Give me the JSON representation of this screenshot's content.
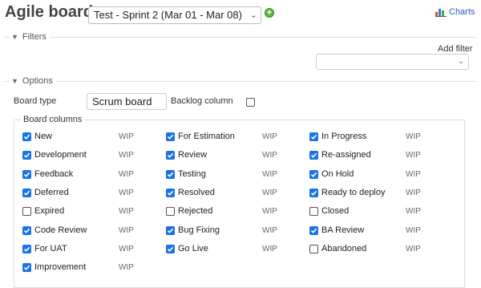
{
  "header": {
    "title": "Agile board",
    "sprint_value": "Test - Sprint 2 (Mar 01 - Mar 08)",
    "charts_label": "Charts"
  },
  "filters": {
    "legend": "Filters",
    "add_filter_label": "Add filter",
    "add_filter_value": ""
  },
  "options": {
    "legend": "Options",
    "board_type_label": "Board type",
    "board_type_value": "Scrum board",
    "backlog_label": "Backlog column",
    "backlog_checked": false,
    "board_columns_legend": "Board columns"
  },
  "columns": [
    [
      {
        "label": "New",
        "checked": true,
        "wip": "WIP"
      },
      {
        "label": "Development",
        "checked": true,
        "wip": "WIP"
      },
      {
        "label": "Feedback",
        "checked": true,
        "wip": "WIP"
      },
      {
        "label": "Deferred",
        "checked": true,
        "wip": "WIP"
      },
      {
        "label": "Expired",
        "checked": false,
        "wip": "WIP"
      },
      {
        "label": "Code Review",
        "checked": true,
        "wip": "WIP"
      },
      {
        "label": "For UAT",
        "checked": true,
        "wip": "WIP"
      },
      {
        "label": "Improvement",
        "checked": true,
        "wip": "WIP"
      }
    ],
    [
      {
        "label": "For Estimation",
        "checked": true,
        "wip": "WIP"
      },
      {
        "label": "Review",
        "checked": true,
        "wip": "WIP"
      },
      {
        "label": "Testing",
        "checked": true,
        "wip": "WIP"
      },
      {
        "label": "Resolved",
        "checked": true,
        "wip": "WIP"
      },
      {
        "label": "Rejected",
        "checked": false,
        "wip": "WIP"
      },
      {
        "label": "Bug Fixing",
        "checked": true,
        "wip": "WIP"
      },
      {
        "label": "Go Live",
        "checked": true,
        "wip": "WIP"
      }
    ],
    [
      {
        "label": "In Progress",
        "checked": true,
        "wip": "WIP"
      },
      {
        "label": "Re-assigned",
        "checked": true,
        "wip": "WIP"
      },
      {
        "label": "On Hold",
        "checked": true,
        "wip": "WIP"
      },
      {
        "label": "Ready to deploy",
        "checked": true,
        "wip": "WIP"
      },
      {
        "label": "Closed",
        "checked": false,
        "wip": "WIP"
      },
      {
        "label": "BA Review",
        "checked": true,
        "wip": "WIP"
      },
      {
        "label": "Abandoned",
        "checked": false,
        "wip": "WIP"
      }
    ]
  ],
  "colors": {
    "checkbox_on": "#1a73e8",
    "link": "#2a5bbf",
    "add_button": "#5bb640"
  }
}
